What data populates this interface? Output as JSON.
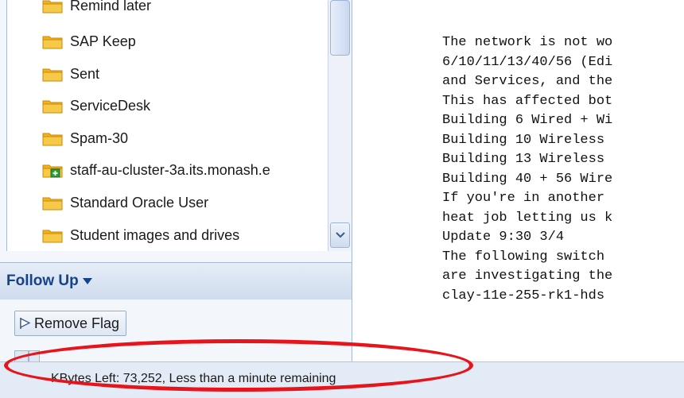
{
  "folders": [
    {
      "label": "Remind later",
      "icon": "folder-icon"
    },
    {
      "label": "SAP Keep",
      "icon": "folder-icon"
    },
    {
      "label": "Sent",
      "icon": "folder-icon"
    },
    {
      "label": "ServiceDesk",
      "icon": "folder-icon"
    },
    {
      "label": "Spam-30",
      "icon": "folder-icon"
    },
    {
      "label": "staff-au-cluster-3a.its.monash.e",
      "icon": "public-folder-icon"
    },
    {
      "label": "Standard Oracle User",
      "icon": "folder-icon"
    },
    {
      "label": "Student images and drives",
      "icon": "folder-icon"
    }
  ],
  "follow_up": {
    "title": "Follow Up",
    "remove_flag_label": "Remove Flag"
  },
  "message_lines": [
    "The network is not wo",
    "6/10/11/13/40/56 (Edi",
    "and Services, and the",
    "This has affected bot",
    "Building 6 Wired + Wi",
    "Building 10 Wireless",
    "Building 13 Wireless",
    "Building 40 + 56 Wire",
    "If you're in another",
    "heat job letting us k",
    "Update 9:30 3/4",
    "The following switch",
    "are investigating the",
    "clay-11e-255-rk1-hds"
  ],
  "status": {
    "text": "KBytes Left: 73,252, Less than a minute remaining"
  },
  "colors": {
    "accent": "#15428b",
    "highlight_ellipse": "#e8141c",
    "folder": "#f2b21c"
  }
}
